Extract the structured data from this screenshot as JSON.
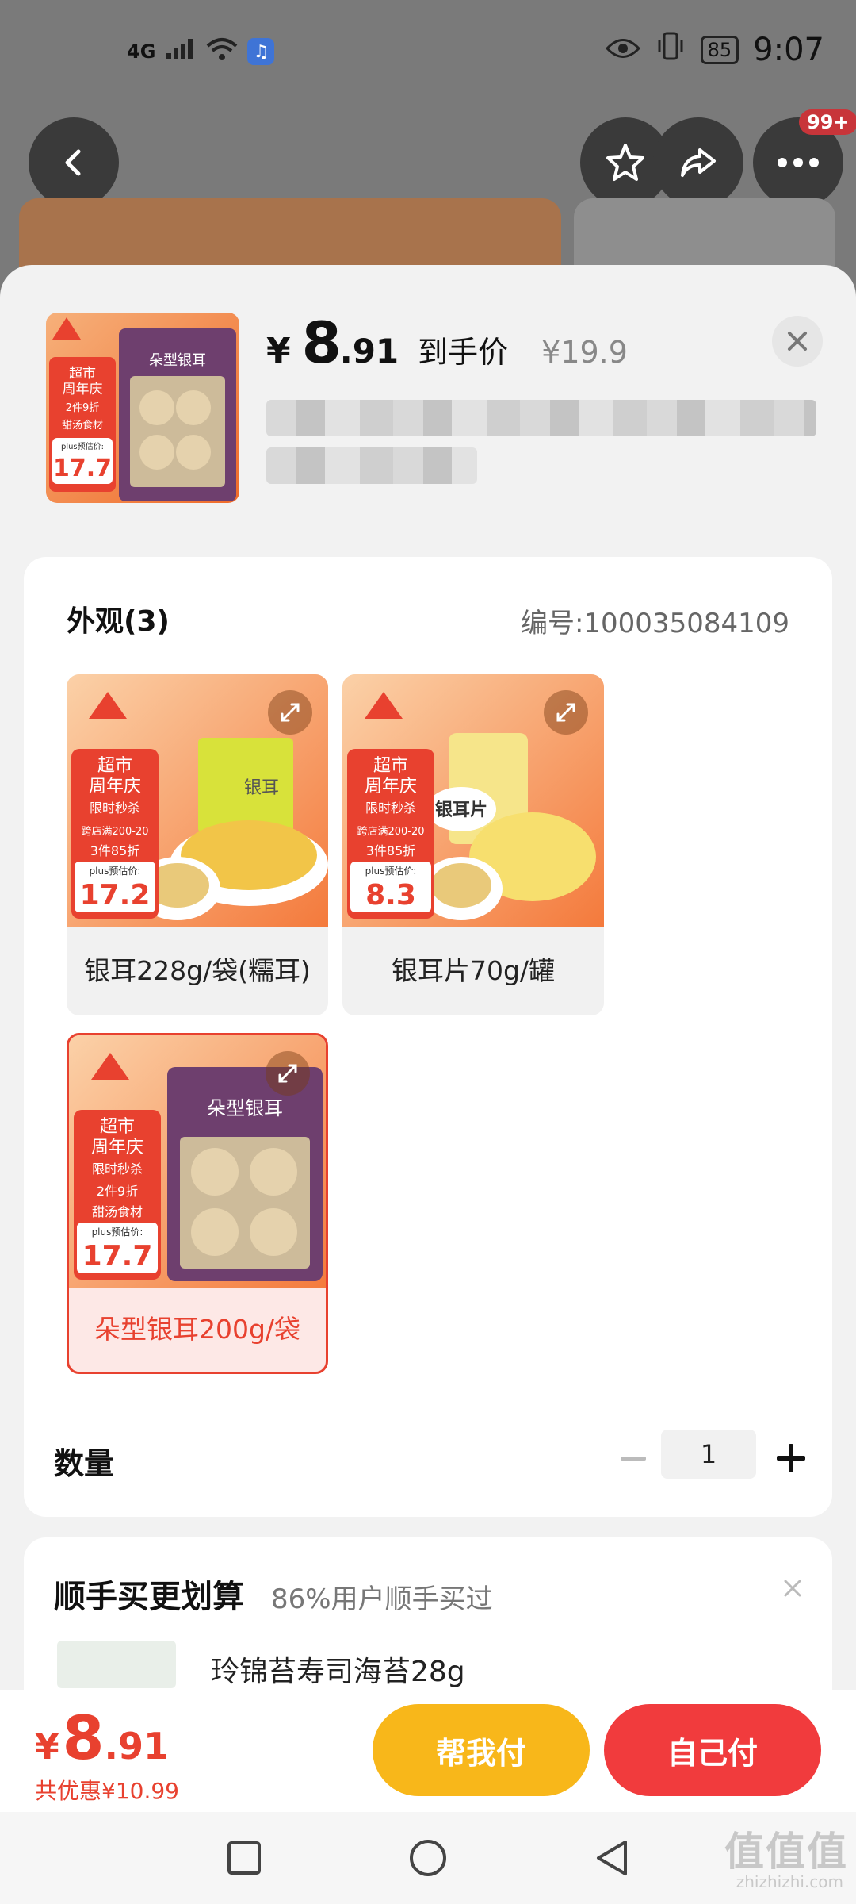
{
  "status_bar": {
    "network": "4G",
    "time": "9:07",
    "battery": "85"
  },
  "top_nav": {
    "badge": "99+"
  },
  "header": {
    "currency": "¥",
    "price_int": "8",
    "price_dec": ".91",
    "price_tag": "到手价",
    "original_price": "¥19.9",
    "thumb_promo": {
      "l1": "超市",
      "l2": "周年庆",
      "l3": "2件9折",
      "l4": "甜汤食材",
      "plus": "plus预估价:",
      "price": "17.7",
      "product": "朵型银耳"
    }
  },
  "spec": {
    "title": "外观(3)",
    "sku_code": "编号:100035084109",
    "options": [
      {
        "label": "银耳228g/袋(糯耳)",
        "selected": false,
        "promo": [
          "超市",
          "周年庆",
          "限时秒杀",
          "跨店满200-20",
          "3件85折"
        ],
        "plus": "plus预估价:",
        "price": "17.2",
        "product_tag": "银耳"
      },
      {
        "label": "银耳片70g/罐",
        "selected": false,
        "promo": [
          "超市",
          "周年庆",
          "限时秒杀",
          "跨店满200-20",
          "3件85折"
        ],
        "plus": "plus预估价:",
        "price": "8.3",
        "product_tag": "银耳片"
      },
      {
        "label": "朵型银耳200g/袋",
        "selected": true,
        "promo": [
          "超市",
          "周年庆",
          "限时秒杀",
          "2件9折",
          "甜汤食材"
        ],
        "plus": "plus预估价:",
        "price": "17.7",
        "product_tag": "朵型银耳"
      }
    ],
    "quantity_label": "数量",
    "quantity": "1"
  },
  "upsell": {
    "title": "顺手买更划算",
    "subtitle": "86%用户顺手买过",
    "item_text": "玲锦苔寿司海苔28g"
  },
  "footer": {
    "currency": "¥",
    "price_int": "8",
    "price_dec": ".91",
    "saving": "共优惠¥10.99",
    "help_pay": "帮我付",
    "self_pay": "自己付"
  },
  "watermark": {
    "main": "值值值",
    "sub": "zhizhizhi.com"
  },
  "colors": {
    "accent_red": "#e8412f",
    "pay_yellow": "#f8b71a",
    "pay_red": "#f13b3d"
  }
}
